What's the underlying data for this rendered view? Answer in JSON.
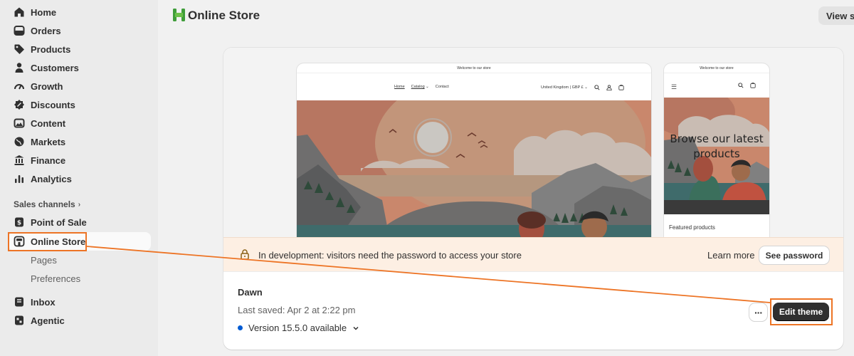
{
  "sidebar": {
    "items": [
      {
        "label": "Home",
        "icon": "home-icon"
      },
      {
        "label": "Orders",
        "icon": "orders-icon"
      },
      {
        "label": "Products",
        "icon": "tag-icon"
      },
      {
        "label": "Customers",
        "icon": "person-icon"
      },
      {
        "label": "Growth",
        "icon": "gauge-icon"
      },
      {
        "label": "Discounts",
        "icon": "discount-icon"
      },
      {
        "label": "Content",
        "icon": "image-icon"
      },
      {
        "label": "Markets",
        "icon": "globe-icon"
      },
      {
        "label": "Finance",
        "icon": "bank-icon"
      },
      {
        "label": "Analytics",
        "icon": "bar-chart-icon"
      }
    ],
    "sales_channels_label": "Sales channels",
    "channels": [
      {
        "label": "Point of Sale",
        "icon": "pos-icon"
      },
      {
        "label": "Online Store",
        "icon": "store-icon"
      }
    ],
    "online_store_sub": [
      "Pages",
      "Preferences"
    ],
    "apps": [
      {
        "label": "Inbox",
        "icon": "inbox-icon"
      },
      {
        "label": "Agentic",
        "icon": "agentic-icon"
      }
    ]
  },
  "header": {
    "title": "Online Store",
    "view_button": "View st"
  },
  "preview": {
    "announcement": "Welcome to our store",
    "nav_links": [
      "Home",
      "Catalog",
      "Contact"
    ],
    "locale": "United Kingdom | GBP £",
    "mobile_hero_text": "Browse our latest products",
    "featured": "Featured products"
  },
  "banner": {
    "message": "In development: visitors need the password to access your store",
    "learn_more": "Learn more",
    "see_password": "See password"
  },
  "theme": {
    "name": "Dawn",
    "last_saved": "Last saved: Apr 2 at 2:22 pm",
    "version": "Version 15.5.0 available",
    "more_label": "···",
    "edit_button": "Edit theme"
  },
  "colors": {
    "accent": "#ed7425",
    "sidebar_bg": "#ebebeb",
    "banner_bg": "#fdefe3",
    "primary_button": "#303030",
    "version_dot": "#005bd3",
    "store_logo": "#3f9d3a"
  }
}
